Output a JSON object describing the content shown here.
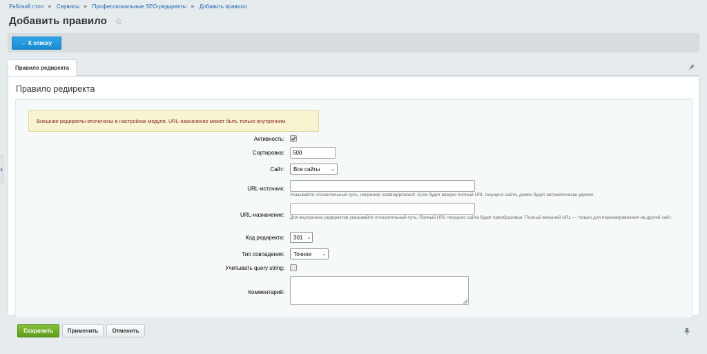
{
  "breadcrumb": [
    "Рабочий стол",
    "Сервисы",
    "Профессиональные SEO-редиректы",
    "Добавить правило"
  ],
  "page_title": "Добавить правило",
  "toolbar": {
    "back_label": "← К списку"
  },
  "tabs": [
    {
      "label": "Правило редиректа"
    }
  ],
  "panel": {
    "title": "Правило редиректа",
    "alert": "Внешние редиректы отключены в настройках модуля. URL-назначение может быть только внутренним."
  },
  "form": {
    "active": {
      "label": "Активность:",
      "checked": true
    },
    "sort": {
      "label": "Сортировка:",
      "value": "500"
    },
    "site": {
      "label": "Сайт:",
      "value": "Все сайты"
    },
    "source": {
      "label": "URL-источник:",
      "value": "",
      "hint": "Указывайте относительный путь, например /catalog/product/. Если будет введен полный URL текущего сайта, домен будет автоматически удален."
    },
    "target": {
      "label": "URL-назначение:",
      "value": "",
      "hint": "Для внутренних редиректов указывайте относительный путь. Полный URL текущего сайта будет преобразован. Полный внешний URL — только для перенаправления на другой сайт."
    },
    "code": {
      "label": "Код редиректа:",
      "value": "301"
    },
    "match": {
      "label": "Тип совпадения:",
      "value": "Точное"
    },
    "query": {
      "label": "Учитывать query string:",
      "checked": false
    },
    "comment": {
      "label": "Комментарий:",
      "value": ""
    }
  },
  "footer": {
    "save": "Сохранить",
    "apply": "Применить",
    "cancel": "Отменить"
  },
  "colors": {
    "accent": "#1a8ad2",
    "save": "#6aa825",
    "alert_text": "#8b2b2b"
  }
}
